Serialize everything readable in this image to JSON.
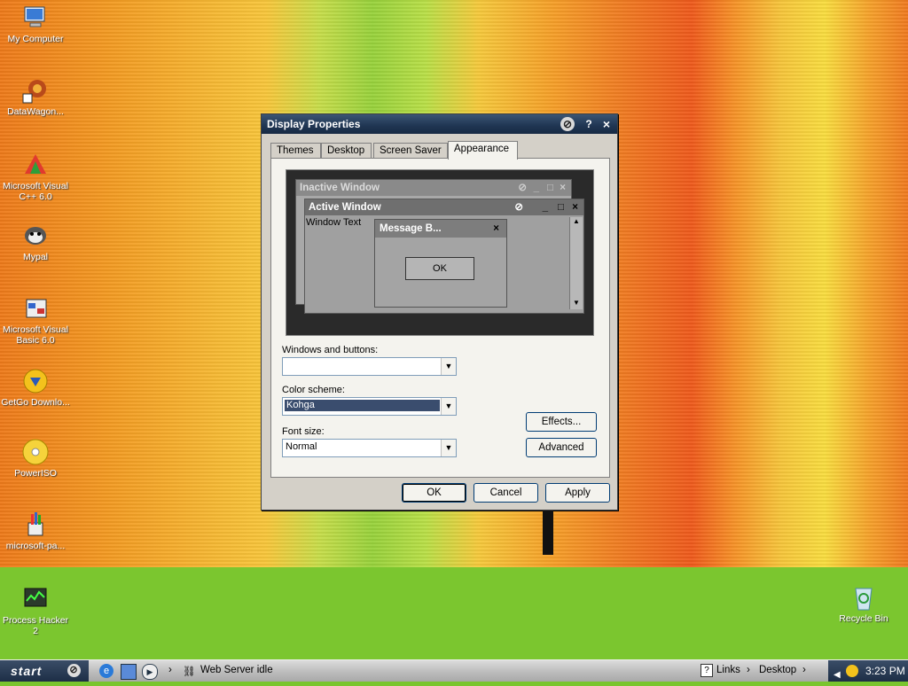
{
  "desktop": {
    "icons": [
      {
        "label": "My Computer"
      },
      {
        "label": "DataWagon..."
      },
      {
        "label": "Microsoft Visual C++ 6.0"
      },
      {
        "label": "Mypal"
      },
      {
        "label": "Microsoft Visual Basic 6.0"
      },
      {
        "label": "GetGo Downlo..."
      },
      {
        "label": "PowerISO"
      },
      {
        "label": "microsoft-pa..."
      },
      {
        "label": "Process Hacker 2"
      },
      {
        "label": "Recycle Bin"
      }
    ]
  },
  "dialog": {
    "title": "Display Properties",
    "help": "?",
    "close": "×",
    "tabs": [
      {
        "label": "Themes"
      },
      {
        "label": "Desktop"
      },
      {
        "label": "Screen Saver"
      },
      {
        "label": "Appearance"
      }
    ],
    "active_tab": "Appearance",
    "preview": {
      "inactive_title": "Inactive Window",
      "active_title": "Active Window",
      "window_text": "Window Text",
      "msgbox_title": "Message B...",
      "msgbox_ok": "OK"
    },
    "windows_buttons_label": "Windows and buttons:",
    "windows_buttons_value": "",
    "color_scheme_label": "Color scheme:",
    "color_scheme_value": "Kohga",
    "font_size_label": "Font size:",
    "font_size_value": "Normal",
    "effects_button": "Effects...",
    "advanced_button": "Advanced",
    "ok_button": "OK",
    "cancel_button": "Cancel",
    "apply_button": "Apply"
  },
  "taskbar": {
    "start_label": "start",
    "task_label": "Web Server idle",
    "links_label": "Links",
    "desktop_label": "Desktop",
    "clock": "3:23 PM"
  },
  "colors": {
    "titlebar": "#1f3552",
    "selection": "#3a4d6e",
    "taskbar_dark": "#1d2e46"
  }
}
